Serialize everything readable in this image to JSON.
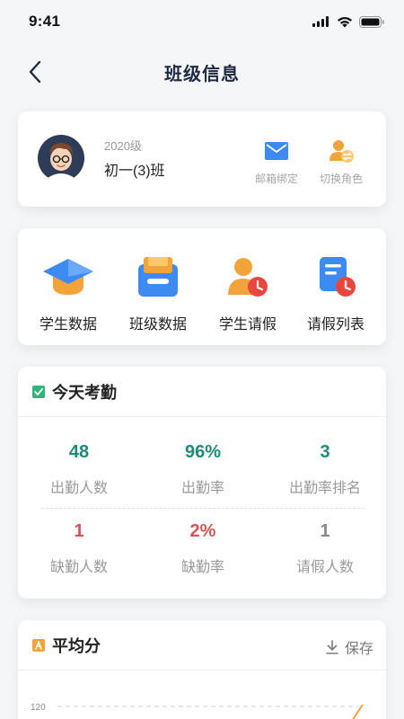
{
  "status_bar": {
    "time": "9:41"
  },
  "nav": {
    "title": "班级信息"
  },
  "profile": {
    "grade": "2020级",
    "class_name": "初一(3)班",
    "email_bind_label": "邮箱绑定",
    "switch_role_label": "切换角色"
  },
  "menu": {
    "items": [
      {
        "label": "学生数据",
        "icon": "graduation-cap-icon"
      },
      {
        "label": "班级数据",
        "icon": "class-box-icon"
      },
      {
        "label": "学生请假",
        "icon": "student-leave-icon"
      },
      {
        "label": "请假列表",
        "icon": "leave-list-icon"
      }
    ]
  },
  "attendance": {
    "title": "今天考勤",
    "stats": [
      {
        "value": "48",
        "label": "出勤人数"
      },
      {
        "value": "96%",
        "label": "出勤率"
      },
      {
        "value": "3",
        "label": "出勤率排名"
      },
      {
        "value": "1",
        "label": "缺勤人数"
      },
      {
        "value": "2%",
        "label": "缺勤率"
      },
      {
        "value": "1",
        "label": "请假人数"
      }
    ]
  },
  "score": {
    "title": "平均分",
    "save_label": "保存",
    "chart_data": {
      "type": "line",
      "y_tick_labels": [
        "120"
      ]
    }
  },
  "colors": {
    "accent_green": "#1e8b7a",
    "accent_red": "#d65454",
    "icon_blue": "#3d8bf2",
    "icon_orange": "#f2a33a"
  }
}
